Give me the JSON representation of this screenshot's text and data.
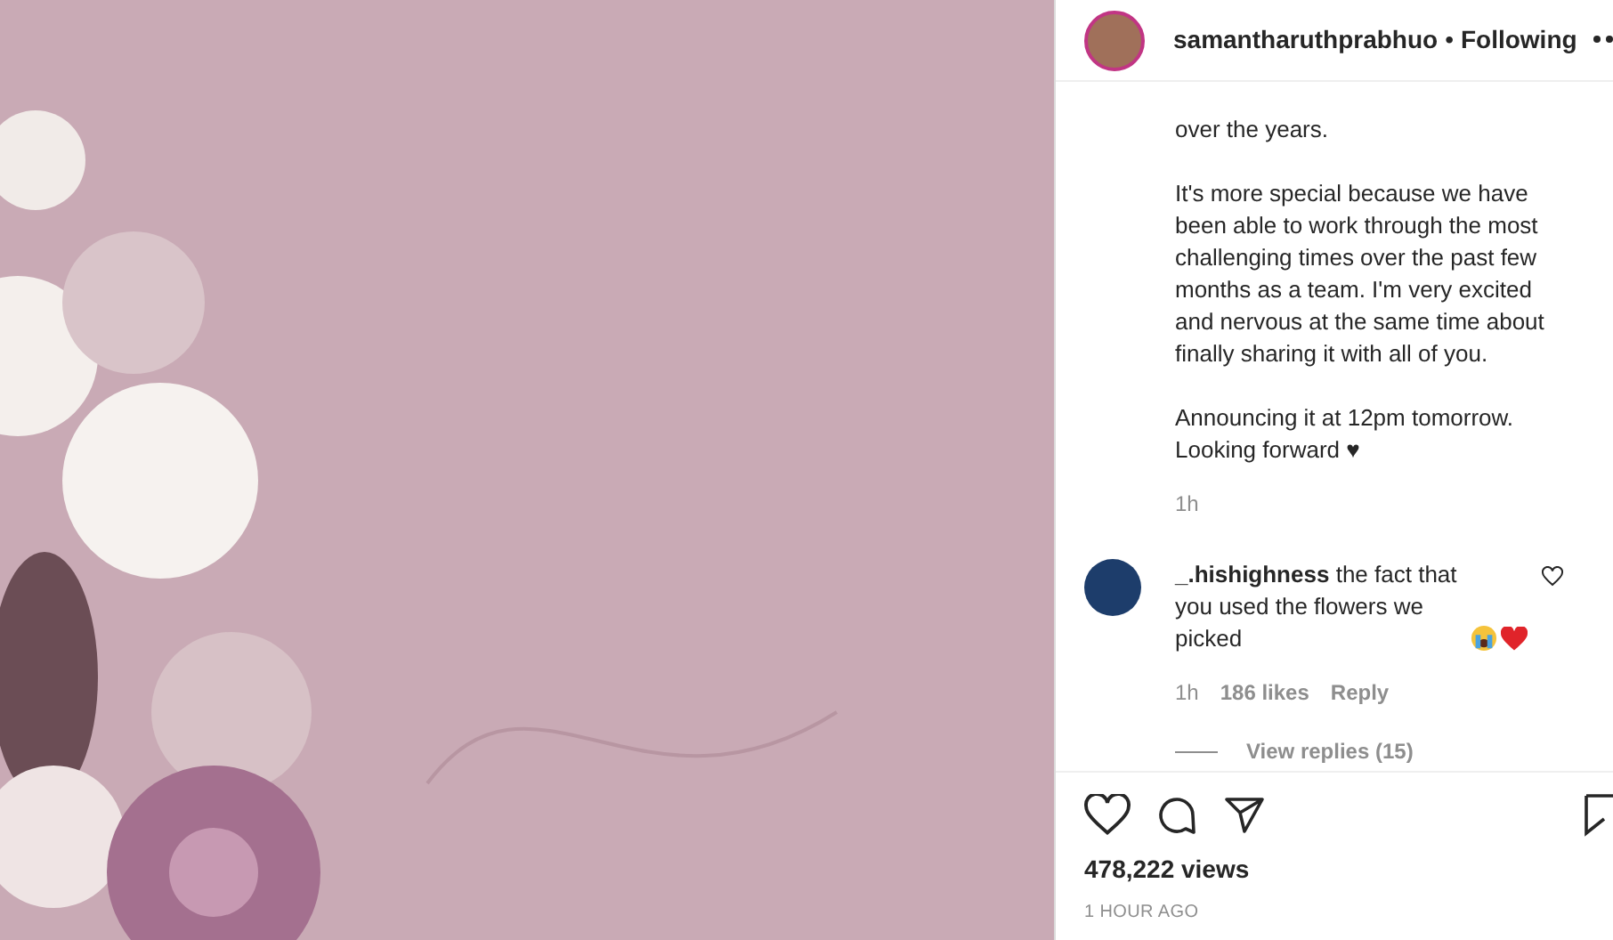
{
  "header": {
    "username": "samantharuthprabhuo",
    "separator": "•",
    "follow_status": "Following"
  },
  "caption": {
    "paragraphs": [
      "over the years.",
      "It's more special because we have been able to work through the most challenging times over the past few months as a team. I'm very excited and nervous at the same time about finally sharing it with all of you.",
      "Announcing it at 12pm tomorrow. Looking forward ♥"
    ],
    "time": "1h"
  },
  "comments": [
    {
      "username": "_.hishighness",
      "text": "the fact that you used the flowers we picked",
      "liked": false,
      "time": "1h",
      "likes": "186 likes",
      "reply": "Reply",
      "view_replies": "View replies (15)"
    }
  ],
  "actions": {
    "liked": false,
    "views": "478,222 views",
    "posted": "1 HOUR AGO"
  }
}
